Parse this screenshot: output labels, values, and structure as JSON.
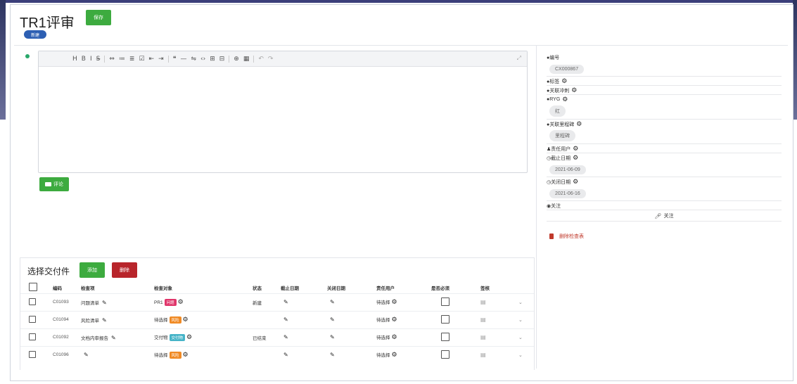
{
  "header": {
    "title": "TR1评审",
    "save_label": "保存",
    "badge": "新建"
  },
  "editor": {
    "toolbar": [
      "H",
      "B",
      "I",
      "S̶",
      "⇔",
      "≔",
      "≣",
      "☑",
      "⇤",
      "⇥",
      "❝",
      "—",
      "⇋",
      "‹›",
      "⊞",
      "⊟",
      "⊕",
      "▦",
      "↶",
      "↷"
    ],
    "fullscreen_icon": "⤢",
    "comment_label": "评论"
  },
  "right_panel": {
    "fields": [
      {
        "label": "●编号",
        "has_gear": false,
        "value": "CX000867"
      },
      {
        "label": "●标签",
        "has_gear": true,
        "value": ""
      },
      {
        "label": "●关联冲刺",
        "has_gear": true,
        "value": ""
      },
      {
        "label": "●RYG",
        "has_gear": true,
        "value": "红"
      },
      {
        "label": "●关联里程碑",
        "has_gear": true,
        "value": "里程碑"
      },
      {
        "label": "♟责任用户",
        "has_gear": true,
        "value": ""
      },
      {
        "label": "◷截止日期",
        "has_gear": true,
        "value": "2021-06-09"
      },
      {
        "label": "◷关闭日期",
        "has_gear": true,
        "value": "2021-06-16"
      },
      {
        "label": "◉关注",
        "has_gear": false,
        "value": ""
      }
    ],
    "watch_label": "关注",
    "delete_label": "删除检查表"
  },
  "deliverables": {
    "title": "选择交付件",
    "add_label": "添加",
    "delete_label": "删除",
    "columns": [
      "编码",
      "检查项",
      "检查对象",
      "状态",
      "截止日期",
      "关闭日期",
      "责任用户",
      "是否必须",
      "签核"
    ],
    "rows": [
      {
        "code": "C01093",
        "item": "问题清单",
        "target": "PR1",
        "tag": "问题",
        "tag_color": "red",
        "status": "新建",
        "owner": "待选择"
      },
      {
        "code": "C01094",
        "item": "风险清单",
        "target": "待选择",
        "tag": "风险",
        "tag_color": "orange",
        "status": "",
        "owner": "待选择"
      },
      {
        "code": "C01092",
        "item": "文档内审报告",
        "target": "交付物",
        "tag": "交付物",
        "tag_color": "teal",
        "status": "已结束",
        "owner": "待选择"
      },
      {
        "code": "C01096",
        "item": "",
        "target": "待选择",
        "tag": "风险",
        "tag_color": "orange",
        "status": "",
        "owner": "待选择"
      }
    ]
  }
}
